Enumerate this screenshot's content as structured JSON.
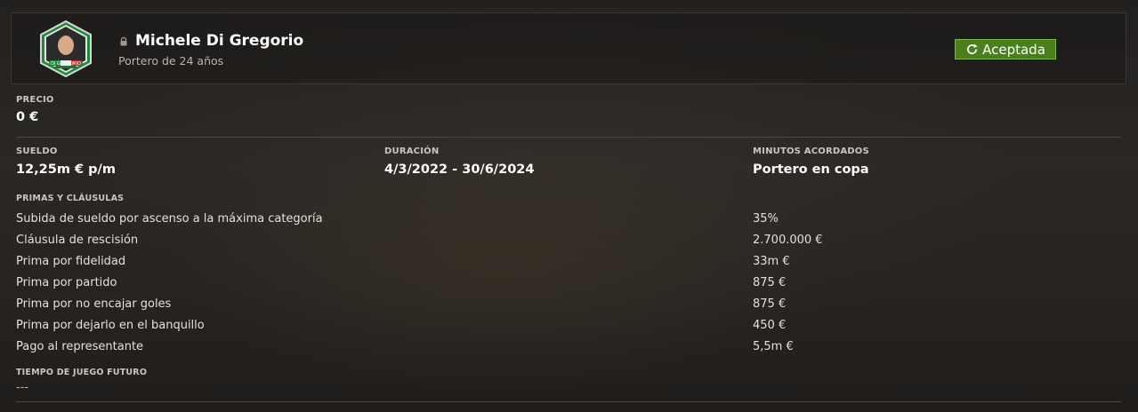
{
  "player": {
    "name": "Michele Di Gregorio",
    "subtitle": "Portero de 24 años",
    "badge_text": "DI GREGORIO"
  },
  "status": {
    "label": "Aceptada",
    "color": "#4a7f1d"
  },
  "price": {
    "label": "PRECIO",
    "value": "0 €"
  },
  "salary": {
    "label": "SUELDO",
    "value": "12,25m € p/m"
  },
  "duration": {
    "label": "DURACIÓN",
    "value": "4/3/2022 - 30/6/2024"
  },
  "minutes": {
    "label": "MINUTOS ACORDADOS",
    "value": "Portero en copa"
  },
  "bonuses": {
    "label": "PRIMAS Y CLÁUSULAS",
    "rows": [
      {
        "label": "Subida de sueldo por ascenso a la máxima categoría",
        "value": "35%"
      },
      {
        "label": "Cláusula de rescisión",
        "value": "2.700.000 €"
      },
      {
        "label": "Prima por fidelidad",
        "value": "33m €"
      },
      {
        "label": "Prima por partido",
        "value": "875 €"
      },
      {
        "label": "Prima por no encajar goles",
        "value": "875 €"
      },
      {
        "label": "Prima por dejarlo en el banquillo",
        "value": "450 €"
      },
      {
        "label": "Pago al representante",
        "value": "5,5m €"
      }
    ]
  },
  "future_playing_time": {
    "label": "TIEMPO DE JUEGO FUTURO",
    "value": "---"
  }
}
